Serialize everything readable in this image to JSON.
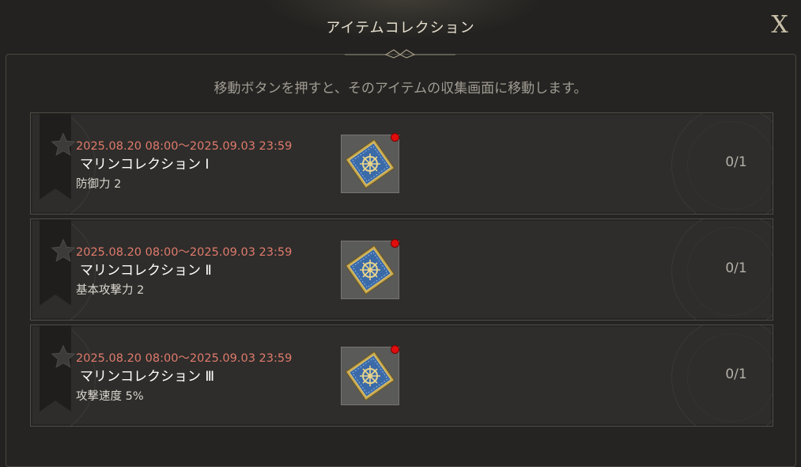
{
  "header": {
    "title": "アイテムコレクション",
    "close_label": "X"
  },
  "hint": "移動ボタンを押すと、そのアイテムの収集画面に移動します。",
  "collections": [
    {
      "period": "2025.08.20 08:00～2025.09.03 23:59",
      "name": "マリンコレクション Ⅰ",
      "stat": "防御力 2",
      "item_icon": "ship-wheel-tile-icon",
      "has_notification": true,
      "progress": "0/1"
    },
    {
      "period": "2025.08.20 08:00～2025.09.03 23:59",
      "name": "マリンコレクション Ⅱ",
      "stat": "基本攻撃力 2",
      "item_icon": "ship-wheel-tile-icon",
      "has_notification": true,
      "progress": "0/1"
    },
    {
      "period": "2025.08.20 08:00～2025.09.03 23:59",
      "name": "マリンコレクション Ⅲ",
      "stat": "攻撃速度 5%",
      "item_icon": "ship-wheel-tile-icon",
      "has_notification": true,
      "progress": "0/1"
    }
  ],
  "colors": {
    "background": "#232220",
    "period_text": "#e07a6c",
    "notification_dot": "#e00d0d",
    "title_text": "#e6dfcf"
  }
}
